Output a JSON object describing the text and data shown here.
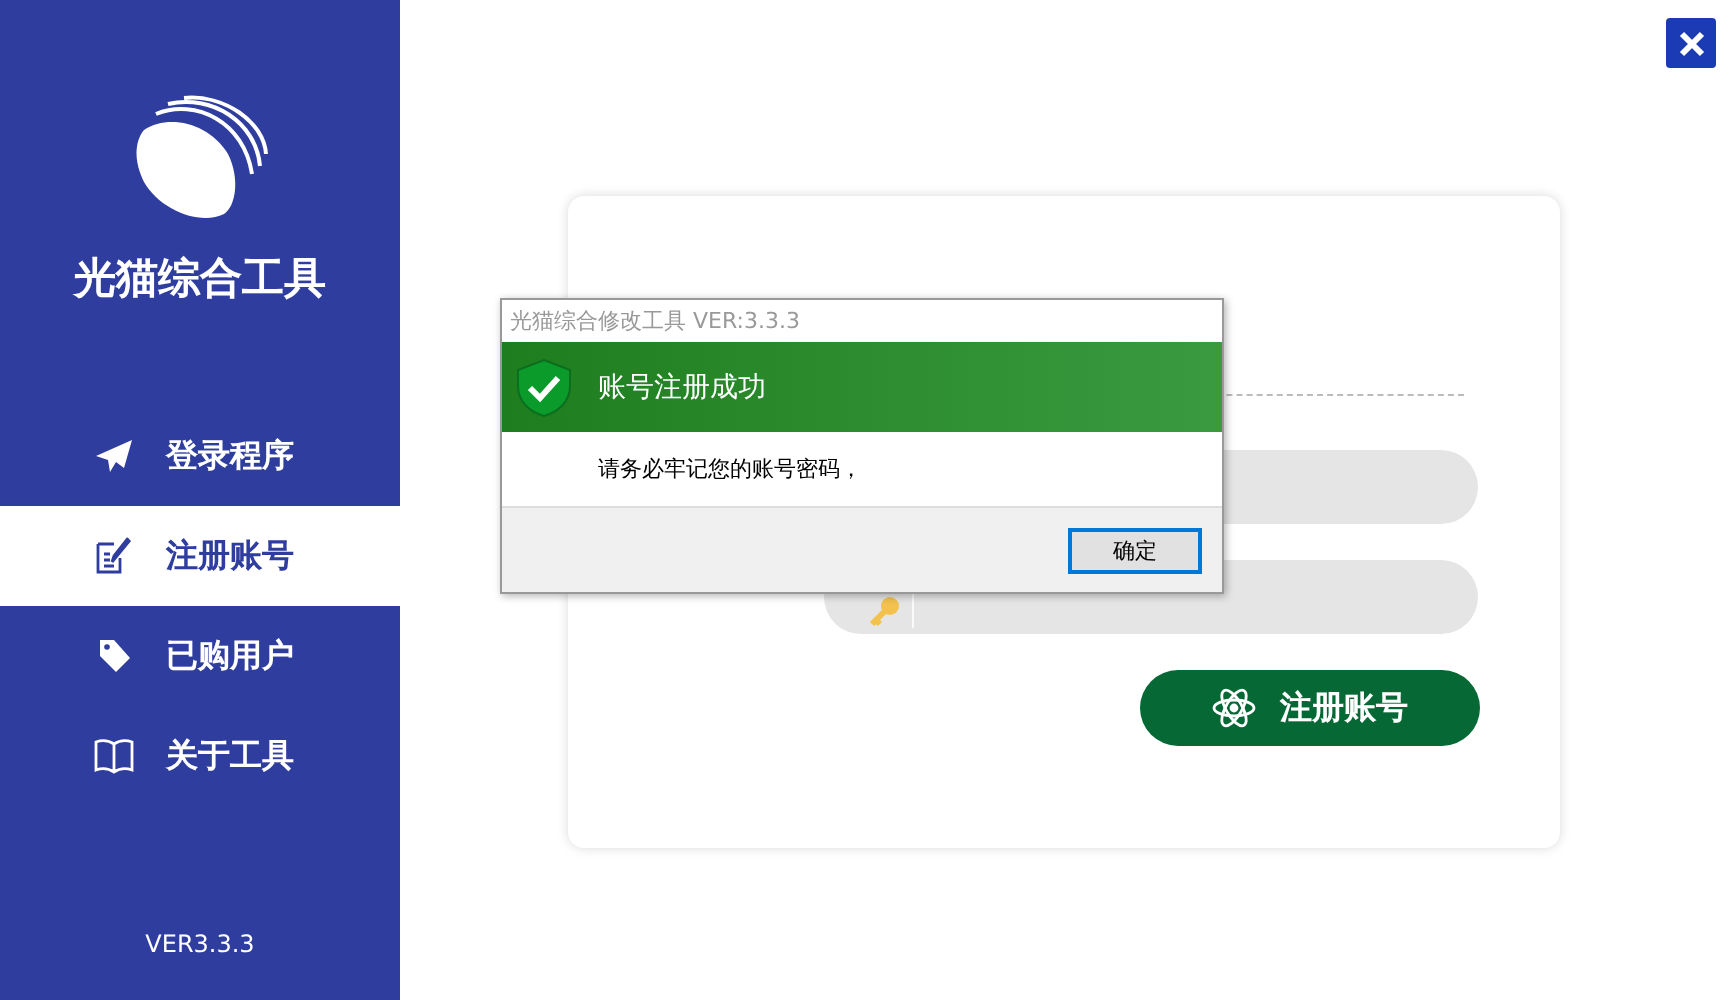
{
  "sidebar": {
    "title": "光猫综合工具",
    "items": [
      {
        "label": "登录程序",
        "selected": false
      },
      {
        "label": "注册账号",
        "selected": true
      },
      {
        "label": "已购用户",
        "selected": false
      },
      {
        "label": "关于工具",
        "selected": false
      }
    ],
    "version": "VER3.3.3"
  },
  "card": {
    "button": "注册账号"
  },
  "dialog": {
    "title": "光猫综合修改工具 VER:3.3.3",
    "header": "账号注册成功",
    "message": "请务必牢记您的账号密码，",
    "button": "确定"
  }
}
